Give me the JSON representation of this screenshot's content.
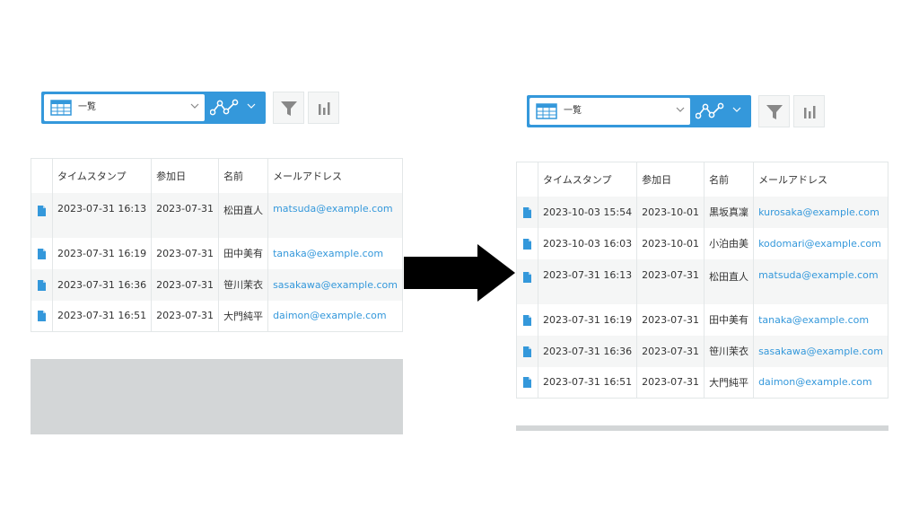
{
  "before": {
    "toolbar": {
      "view_name": "一覧",
      "icons": [
        "table-icon",
        "chevron-down-icon",
        "graph-icon",
        "filter-icon",
        "bar-chart-icon"
      ]
    },
    "columns": [
      "タイムスタンプ",
      "参加日",
      "名前",
      "メールアドレス"
    ],
    "rows": [
      {
        "timestamp": "2023-07-31 16:13",
        "date": "2023-07-31",
        "name": "松田直人",
        "email": "matsuda@example.com"
      },
      {
        "timestamp": "2023-07-31 16:19",
        "date": "2023-07-31",
        "name": "田中美有",
        "email": "tanaka@example.com"
      },
      {
        "timestamp": "2023-07-31 16:36",
        "date": "2023-07-31",
        "name": "笹川茉衣",
        "email": "sasakawa@example.com"
      },
      {
        "timestamp": "2023-07-31 16:51",
        "date": "2023-07-31",
        "name": "大門純平",
        "email": "daimon@example.com"
      }
    ]
  },
  "after": {
    "toolbar": {
      "view_name": "一覧",
      "icons": [
        "table-icon",
        "chevron-down-icon",
        "graph-icon",
        "filter-icon",
        "bar-chart-icon"
      ]
    },
    "columns": [
      "タイムスタンプ",
      "参加日",
      "名前",
      "メールアドレス"
    ],
    "rows": [
      {
        "timestamp": "2023-10-03 15:54",
        "date": "2023-10-01",
        "name": "黒坂真凜",
        "email": "kurosaka@example.com"
      },
      {
        "timestamp": "2023-10-03 16:03",
        "date": "2023-10-01",
        "name": "小泊由美",
        "email": "kodomari@example.com"
      },
      {
        "timestamp": "2023-07-31 16:13",
        "date": "2023-07-31",
        "name": "松田直人",
        "email": "matsuda@example.com"
      },
      {
        "timestamp": "2023-07-31 16:19",
        "date": "2023-07-31",
        "name": "田中美有",
        "email": "tanaka@example.com"
      },
      {
        "timestamp": "2023-07-31 16:36",
        "date": "2023-07-31",
        "name": "笹川茉衣",
        "email": "sasakawa@example.com"
      },
      {
        "timestamp": "2023-07-31 16:51",
        "date": "2023-07-31",
        "name": "大門純平",
        "email": "daimon@example.com"
      }
    ]
  },
  "colors": {
    "accent": "#3498db",
    "arrow": "#000000",
    "gray_block": "#d3d6d7",
    "row_stripe": "#f5f6f6"
  }
}
